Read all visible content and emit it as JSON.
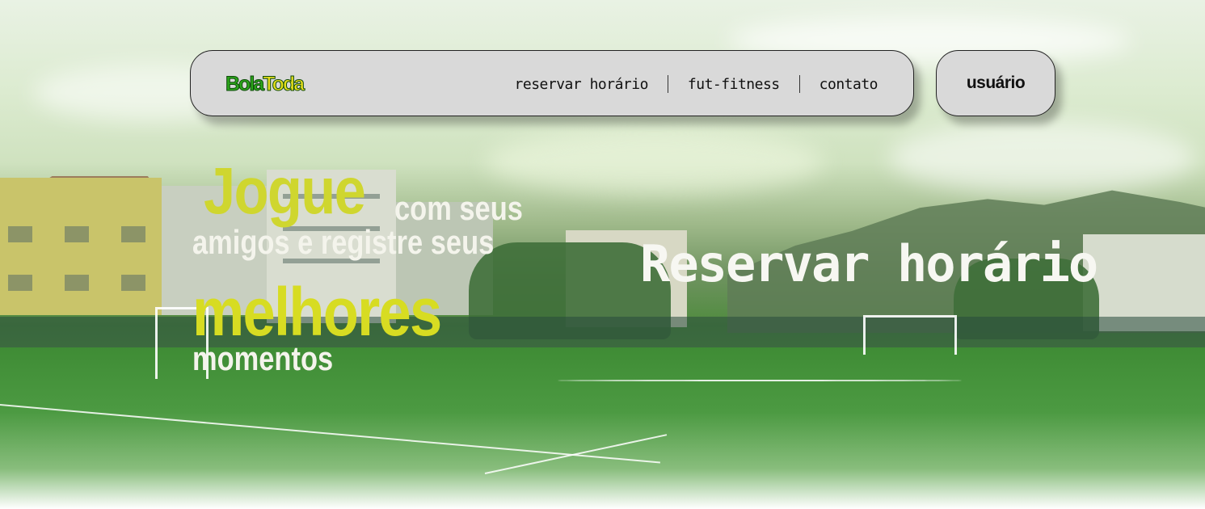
{
  "navbar": {
    "logo": {
      "part1": "Bola",
      "part2": "Toda"
    },
    "links": [
      "reservar horário",
      "fut-fitness",
      "contato"
    ]
  },
  "user_button": "usuário",
  "headline": {
    "word1": "Jogue",
    "line1_rest": "com seus",
    "line2": "amigos e registre seus",
    "word2": "melhores",
    "line4": "momentos"
  },
  "cta": "Reservar horário",
  "colors": {
    "accent_yellow": "#d7dc22",
    "logo_green": "#2ba51a",
    "navbar_bg": "#d9d9d9"
  }
}
